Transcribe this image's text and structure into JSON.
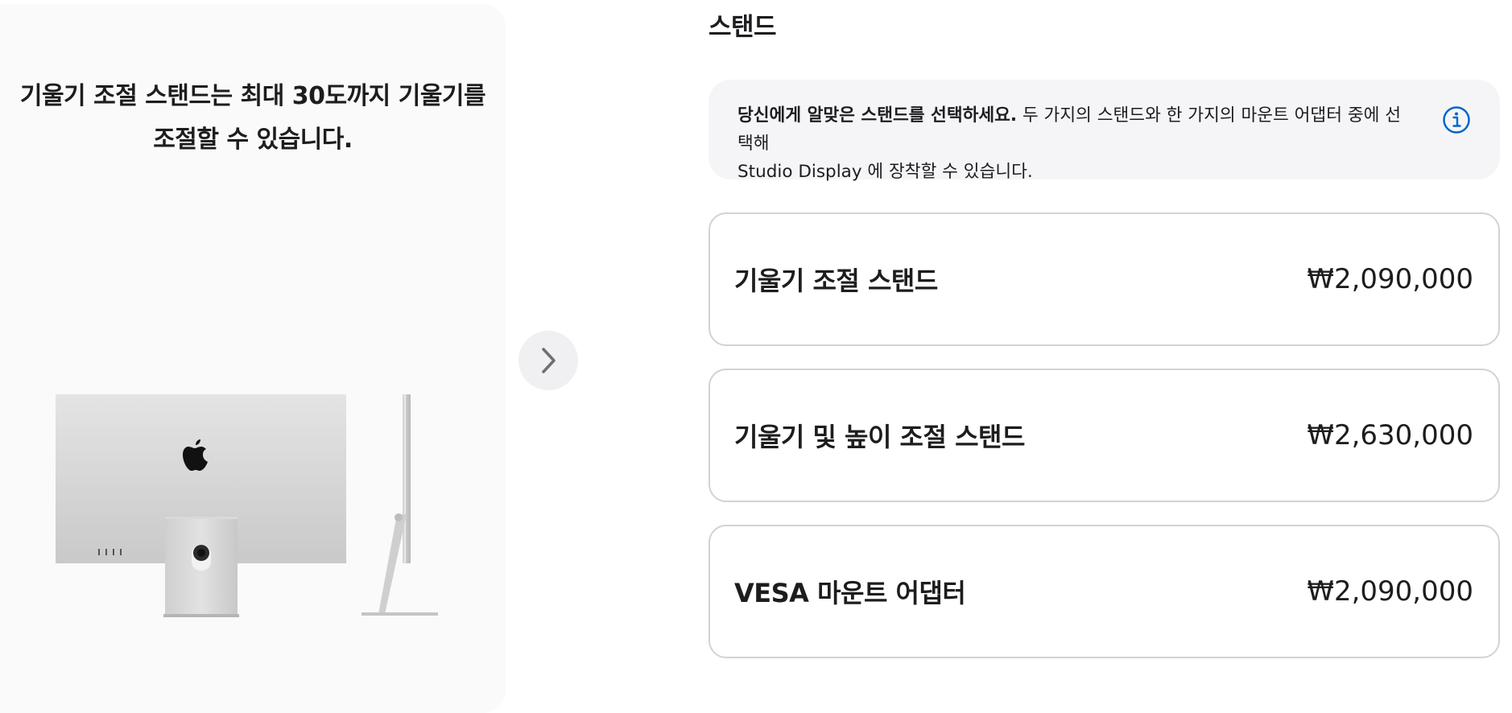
{
  "gallery": {
    "caption_line1": "기울기 조절 스탠드는 최대 30도까지 기울기를",
    "caption_line2": "조절할 수 있습니다.",
    "image_icon": "apple-logo-icon",
    "next_icon": "chevron-right-icon"
  },
  "section": {
    "title": "스탠드"
  },
  "info": {
    "bold_text": "당신에게 알맞은 스탠드를 선택하세요.",
    "text_line1": " 두 가지의 스탠드와 한 가지의 마운트 어댑터 중에 선택해",
    "text_line2": "Studio Display 에 장착할 수 있습니다.",
    "icon": "info-circle-icon",
    "accent_color": "#0066cc"
  },
  "options": [
    {
      "name": "기울기 조절 스탠드",
      "price": "₩2,090,000"
    },
    {
      "name": "기울기 및 높이 조절 스탠드",
      "price": "₩2,630,000"
    },
    {
      "name": "VESA 마운트 어댑터",
      "price": "₩2,090,000"
    }
  ]
}
